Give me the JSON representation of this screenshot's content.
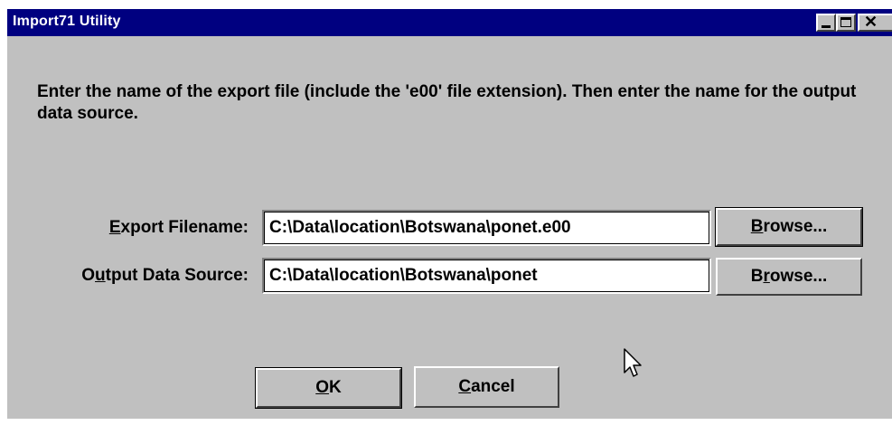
{
  "window": {
    "title": "Import71 Utility",
    "controls": {
      "minimize": "minimize",
      "maximize": "maximize",
      "close": "close"
    }
  },
  "instructions": "Enter the name of the export file (include the 'e00' file extension). Then enter the name for the output data source.",
  "export_row": {
    "label_mnemonic": "E",
    "label_rest": "xport Filename:",
    "value": "C:\\Data\\location\\Botswana\\ponet.e00",
    "browse_mnemonic": "B",
    "browse_rest": "rowse..."
  },
  "output_row": {
    "label_pre": "O",
    "label_mnemonic": "u",
    "label_rest": "tput Data Source:",
    "value": "C:\\Data\\location\\Botswana\\ponet",
    "browse_pre": "B",
    "browse_mnemonic": "r",
    "browse_rest": "owse..."
  },
  "buttons": {
    "ok_mnemonic": "O",
    "ok_rest": "K",
    "cancel_mnemonic": "C",
    "cancel_rest": "ancel"
  },
  "colors": {
    "titlebar": "#000080",
    "dialog_face": "#c0c0c0"
  },
  "icons": {
    "cursor": "arrow-cursor-icon"
  }
}
